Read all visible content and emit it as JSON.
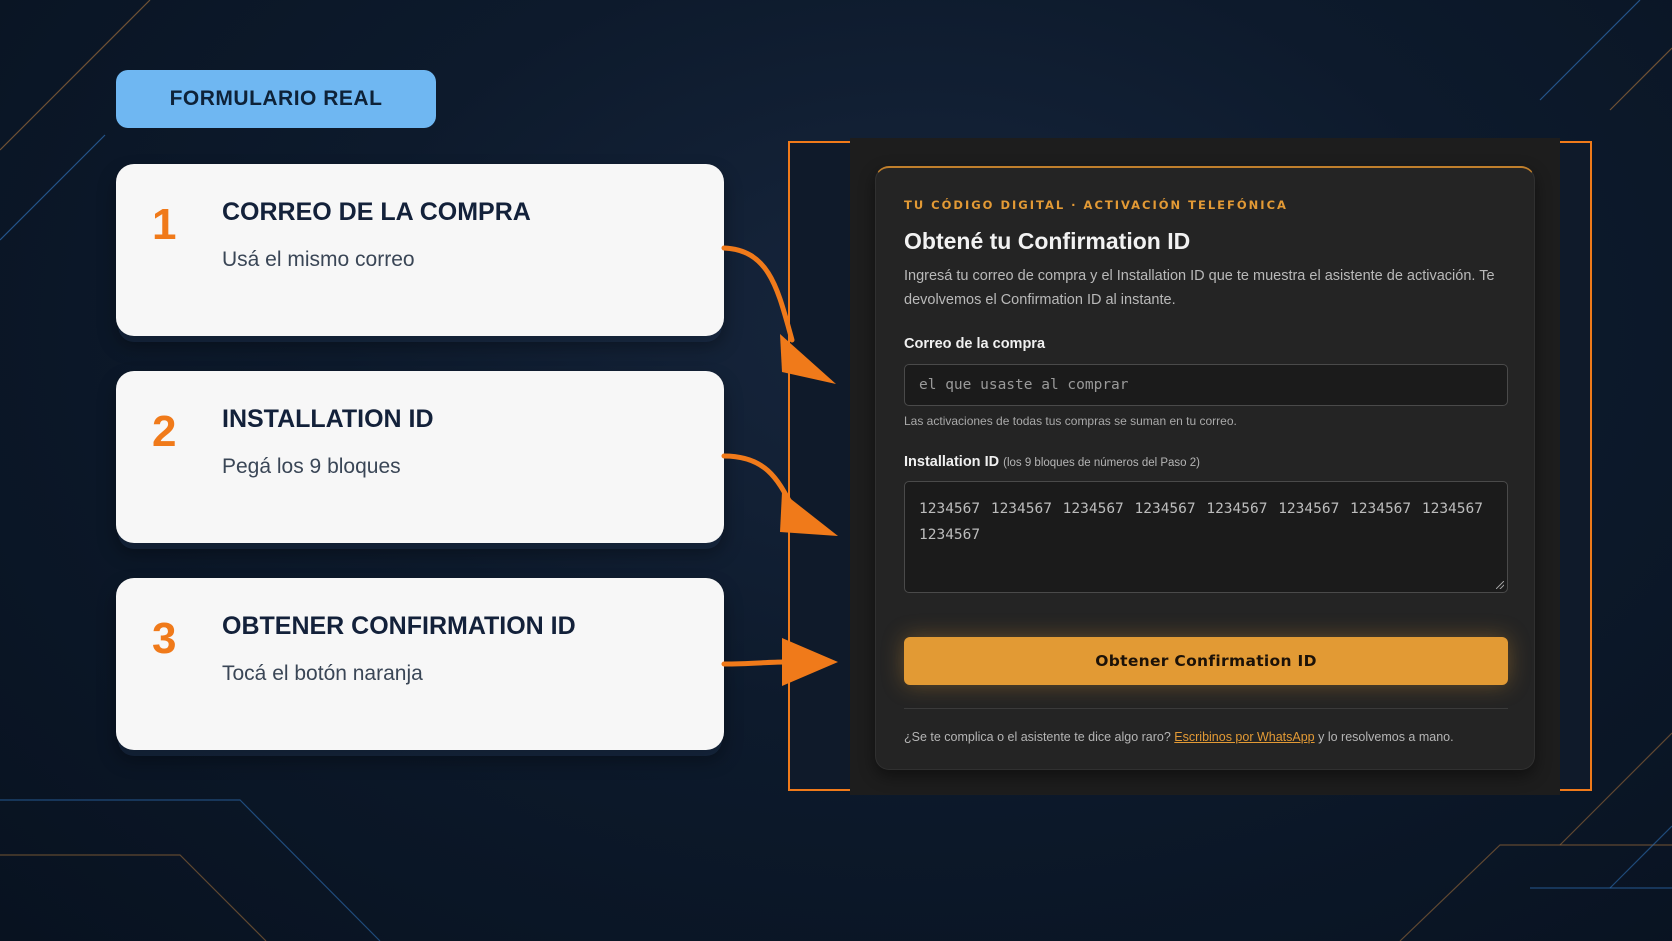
{
  "badge": {
    "label": "FORMULARIO REAL"
  },
  "steps": [
    {
      "number": "1",
      "title": "CORREO DE LA COMPRA",
      "desc": "Usá el mismo correo"
    },
    {
      "number": "2",
      "title": "INSTALLATION ID",
      "desc": "Pegá los 9 bloques"
    },
    {
      "number": "3",
      "title": "OBTENER CONFIRMATION ID",
      "desc": "Tocá el botón naranja"
    }
  ],
  "form": {
    "eyebrow": "TU CÓDIGO DIGITAL · ACTIVACIÓN TELEFÓNICA",
    "title": "Obtené tu Confirmation ID",
    "description": "Ingresá tu correo de compra y el Installation ID que te muestra el asistente de activación. Te devolvemos el Confirmation ID al instante.",
    "email_label": "Correo de la compra",
    "email_placeholder": "el que usaste al comprar",
    "email_help": "Las activaciones de todas tus compras se suman en tu correo.",
    "installation_label": "Installation ID",
    "installation_sublabel": "(los 9 bloques de números del Paso 2)",
    "installation_value": "1234567 1234567 1234567 1234567 1234567 1234567 1234567 1234567 1234567",
    "submit_label": "Obtener Confirmation ID",
    "footer_text_before": "¿Se te complica o el asistente te dice algo raro?",
    "footer_link": "Escribinos por WhatsApp",
    "footer_text_after": "y lo resolvemos a mano."
  },
  "colors": {
    "accent_orange": "#f07a1a",
    "button_orange": "#e29a34",
    "badge_blue": "#6fb7f2",
    "background": "#0d1a2c"
  }
}
